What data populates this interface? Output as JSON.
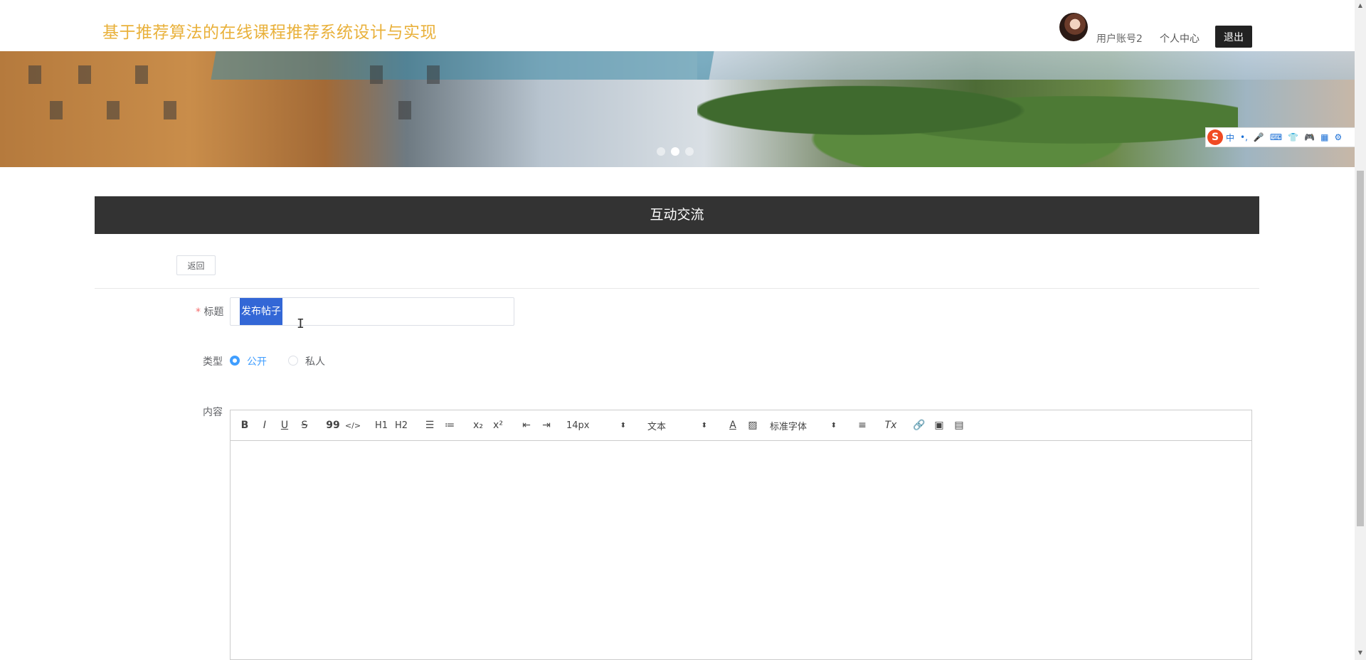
{
  "header": {
    "site_title": "基于推荐算法的在线课程推荐系统设计与实现",
    "user_name": "用户账号2",
    "profile_link": "个人中心",
    "logout_label": "退出"
  },
  "banner": {
    "slide_count": 3,
    "active_slide": 2
  },
  "ime_toolbar": {
    "logo": "S",
    "items": [
      "中",
      "•,",
      "mic-icon",
      "keyboard-icon",
      "shirt-icon",
      "gamepad-icon",
      "grid-icon",
      "gear-icon"
    ],
    "lang": "中",
    "punct": "•,"
  },
  "section": {
    "title": "互动交流",
    "back_label": "返回"
  },
  "form": {
    "title_label": "标题",
    "title_value": "发布帖子",
    "type_label": "类型",
    "type_options": [
      {
        "label": "公开",
        "checked": true
      },
      {
        "label": "私人",
        "checked": false
      }
    ],
    "content_label": "内容"
  },
  "editor": {
    "font_size": "14px",
    "header_select": "文本",
    "font_family": "标准字体",
    "tools": {
      "bold": "B",
      "italic": "I",
      "underline": "U",
      "strike": "S",
      "quote": "99",
      "code": "</>",
      "h1": "H1",
      "h2": "H2",
      "sub": "x₂",
      "sup": "x²",
      "color": "A",
      "clean": "Tx"
    }
  },
  "colors": {
    "accent_title": "#e9b13b",
    "section_bg": "#333333",
    "radio_checked": "#409eff",
    "selection": "#3367d6"
  }
}
